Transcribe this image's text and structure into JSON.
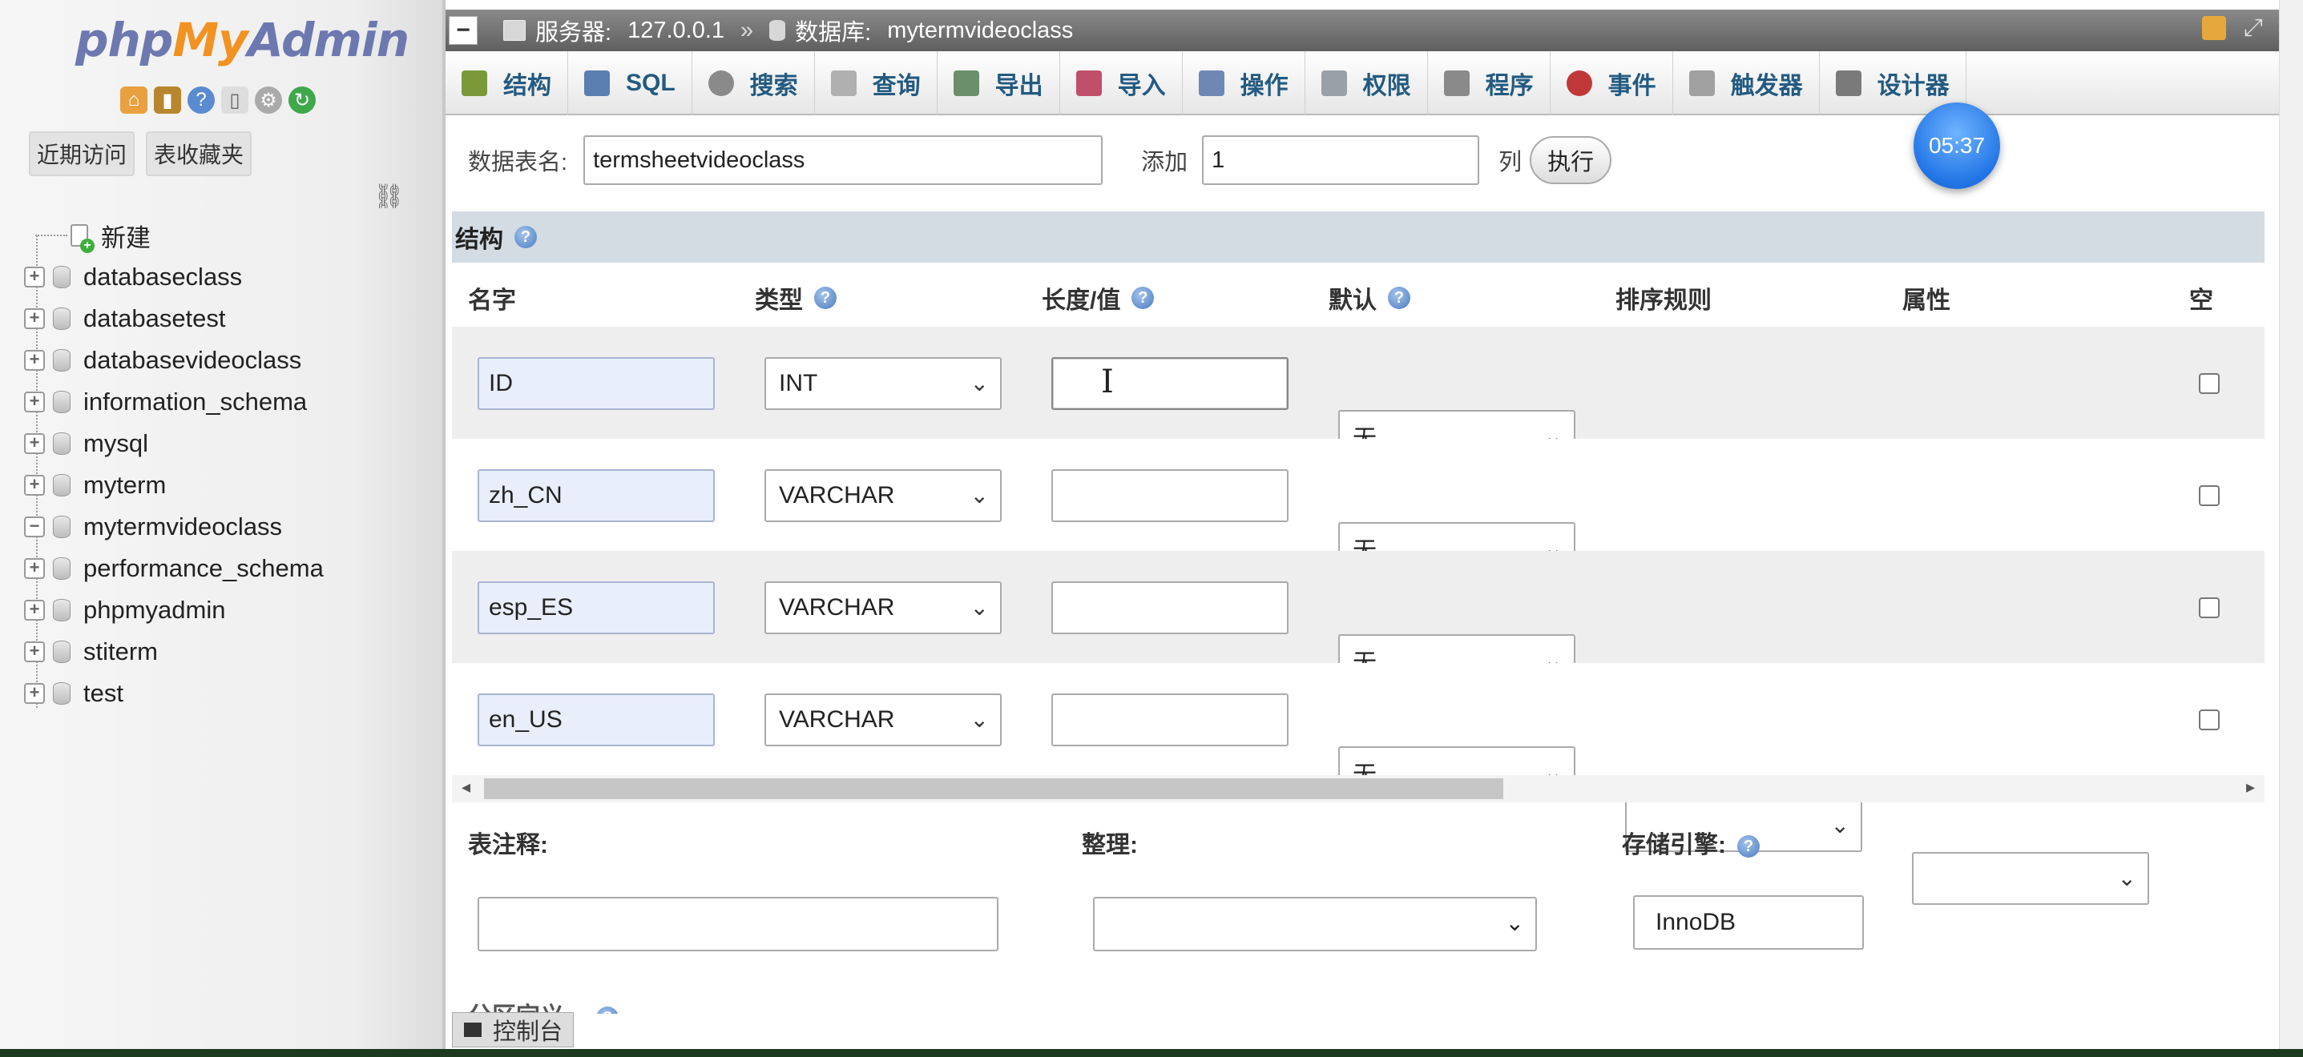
{
  "nav": {
    "logo": {
      "php": "php",
      "my": "My",
      "admin": "Admin"
    },
    "tabs": [
      "近期访问",
      "表收藏夹"
    ],
    "tree": [
      {
        "label": "新建",
        "kind": "new"
      },
      {
        "label": "databaseclass",
        "kind": "db"
      },
      {
        "label": "databasetest",
        "kind": "db"
      },
      {
        "label": "databasevideoclass",
        "kind": "db"
      },
      {
        "label": "information_schema",
        "kind": "db"
      },
      {
        "label": "mysql",
        "kind": "db"
      },
      {
        "label": "myterm",
        "kind": "db"
      },
      {
        "label": "mytermvideoclass",
        "kind": "db",
        "expanded": true
      },
      {
        "label": "performance_schema",
        "kind": "db"
      },
      {
        "label": "phpmyadmin",
        "kind": "db"
      },
      {
        "label": "stiterm",
        "kind": "db"
      },
      {
        "label": "test",
        "kind": "db"
      }
    ]
  },
  "topbar": {
    "server_label": "服务器:",
    "server_value": "127.0.0.1",
    "separator": "»",
    "db_label": "数据库:",
    "db_value": "mytermvideoclass"
  },
  "menu": [
    {
      "label": "结构",
      "icon": "structure-icon",
      "color": "#7a9a3a"
    },
    {
      "label": "SQL",
      "icon": "sql-icon",
      "color": "#5a7fb0"
    },
    {
      "label": "搜索",
      "icon": "search-icon",
      "color": "#8a8a8a"
    },
    {
      "label": "查询",
      "icon": "query-icon",
      "color": "#b0b0b0"
    },
    {
      "label": "导出",
      "icon": "export-icon",
      "color": "#6a8f6a"
    },
    {
      "label": "导入",
      "icon": "import-icon",
      "color": "#c0506a"
    },
    {
      "label": "操作",
      "icon": "wrench-icon",
      "color": "#6f87b5"
    },
    {
      "label": "权限",
      "icon": "privileges-icon",
      "color": "#9aa0a8"
    },
    {
      "label": "程序",
      "icon": "routines-icon",
      "color": "#8a8a8a"
    },
    {
      "label": "事件",
      "icon": "clock-icon",
      "color": "#c03838"
    },
    {
      "label": "触发器",
      "icon": "triggers-icon",
      "color": "#a0a0a0"
    },
    {
      "label": "设计器",
      "icon": "designer-icon",
      "color": "#7a7a7a"
    }
  ],
  "timer": "05:37",
  "form": {
    "table_name_label": "数据表名:",
    "table_name_value": "termsheetvideoclass",
    "add_label": "添加",
    "add_value": "1",
    "columns_label": "列",
    "go_label": "执行",
    "section_title": "结构",
    "col_headers": [
      "名字",
      "类型",
      "长度/值",
      "默认",
      "排序规则",
      "属性",
      "空"
    ],
    "fields": [
      {
        "name": "ID",
        "type": "INT",
        "length": "",
        "default": "无"
      },
      {
        "name": "zh_CN",
        "type": "VARCHAR",
        "length": "",
        "default": "无"
      },
      {
        "name": "esp_ES",
        "type": "VARCHAR",
        "length": "",
        "default": "无"
      },
      {
        "name": "en_US",
        "type": "VARCHAR",
        "length": "",
        "default": "无"
      }
    ],
    "comment_label": "表注释:",
    "collation_label": "整理:",
    "engine_label": "存储引擎:",
    "engine_value": "InnoDB",
    "partition_label": "分区定义:"
  },
  "console_label": "控制台",
  "colors": {
    "accent": "#235a81",
    "section_bg": "#d3dce3",
    "name_input_bg": "#e8eefa"
  }
}
